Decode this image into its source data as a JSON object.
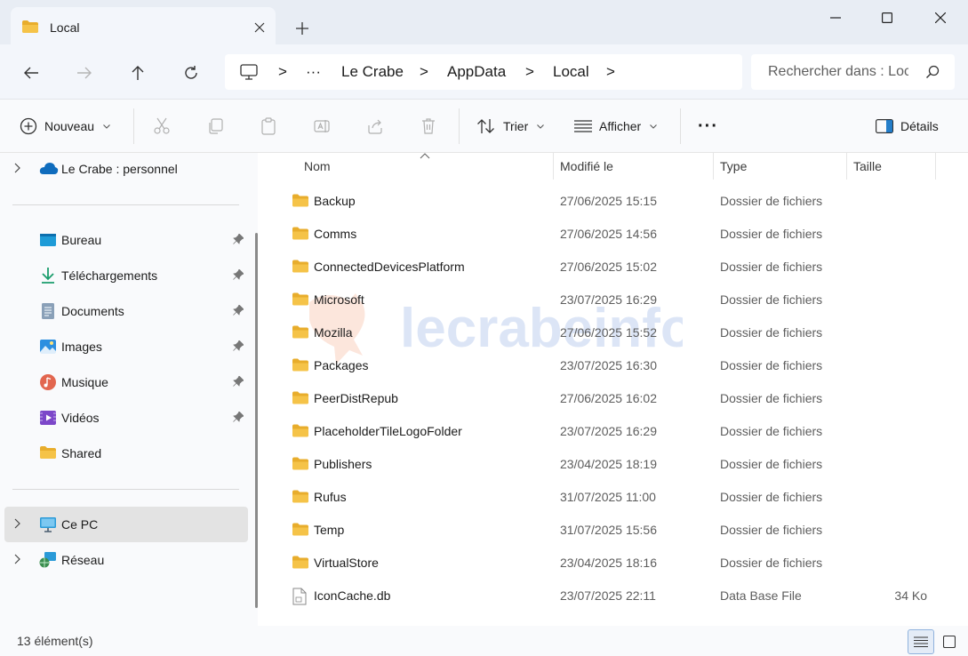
{
  "window": {
    "tab_title": "Local",
    "colors": {
      "accent": "#0067c0",
      "folder": "#f5c348",
      "folder_dark": "#e8ad2c"
    }
  },
  "address": {
    "sep": ">",
    "more": "···",
    "crumbs": [
      "Le Crabe",
      "AppData",
      "Local"
    ],
    "search_placeholder": "Rechercher dans : Local"
  },
  "toolbar": {
    "new_label": "Nouveau",
    "sort_label": "Trier",
    "view_label": "Afficher",
    "more_label": "···",
    "details_label": "Détails"
  },
  "sidebar": {
    "onedrive_label": "Le Crabe : personnel",
    "quick_access": [
      {
        "label": "Bureau",
        "icon": "desktop-icon"
      },
      {
        "label": "Téléchargements",
        "icon": "download-icon"
      },
      {
        "label": "Documents",
        "icon": "documents-icon"
      },
      {
        "label": "Images",
        "icon": "pictures-icon"
      },
      {
        "label": "Musique",
        "icon": "music-icon"
      },
      {
        "label": "Vidéos",
        "icon": "videos-icon"
      },
      {
        "label": "Shared",
        "icon": "folder-icon"
      }
    ],
    "this_pc_label": "Ce PC",
    "network_label": "Réseau"
  },
  "columns": {
    "name": "Nom",
    "modified": "Modifié le",
    "type": "Type",
    "size": "Taille"
  },
  "files": [
    {
      "name": "Backup",
      "modified": "27/06/2025 15:15",
      "type": "Dossier de fichiers",
      "size": "",
      "kind": "folder"
    },
    {
      "name": "Comms",
      "modified": "27/06/2025 14:56",
      "type": "Dossier de fichiers",
      "size": "",
      "kind": "folder"
    },
    {
      "name": "ConnectedDevicesPlatform",
      "modified": "27/06/2025 15:02",
      "type": "Dossier de fichiers",
      "size": "",
      "kind": "folder"
    },
    {
      "name": "Microsoft",
      "modified": "23/07/2025 16:29",
      "type": "Dossier de fichiers",
      "size": "",
      "kind": "folder"
    },
    {
      "name": "Mozilla",
      "modified": "27/06/2025 15:52",
      "type": "Dossier de fichiers",
      "size": "",
      "kind": "folder"
    },
    {
      "name": "Packages",
      "modified": "23/07/2025 16:30",
      "type": "Dossier de fichiers",
      "size": "",
      "kind": "folder"
    },
    {
      "name": "PeerDistRepub",
      "modified": "27/06/2025 16:02",
      "type": "Dossier de fichiers",
      "size": "",
      "kind": "folder"
    },
    {
      "name": "PlaceholderTileLogoFolder",
      "modified": "23/07/2025 16:29",
      "type": "Dossier de fichiers",
      "size": "",
      "kind": "folder"
    },
    {
      "name": "Publishers",
      "modified": "23/04/2025 18:19",
      "type": "Dossier de fichiers",
      "size": "",
      "kind": "folder"
    },
    {
      "name": "Rufus",
      "modified": "31/07/2025 11:00",
      "type": "Dossier de fichiers",
      "size": "",
      "kind": "folder"
    },
    {
      "name": "Temp",
      "modified": "31/07/2025 15:56",
      "type": "Dossier de fichiers",
      "size": "",
      "kind": "folder"
    },
    {
      "name": "VirtualStore",
      "modified": "23/04/2025 18:16",
      "type": "Dossier de fichiers",
      "size": "",
      "kind": "folder"
    },
    {
      "name": "IconCache.db",
      "modified": "23/07/2025 22:11",
      "type": "Data Base File",
      "size": "34 Ko",
      "kind": "file"
    }
  ],
  "watermark_text": "lecrabeinfo",
  "status": {
    "count": "13 élément(s)"
  }
}
